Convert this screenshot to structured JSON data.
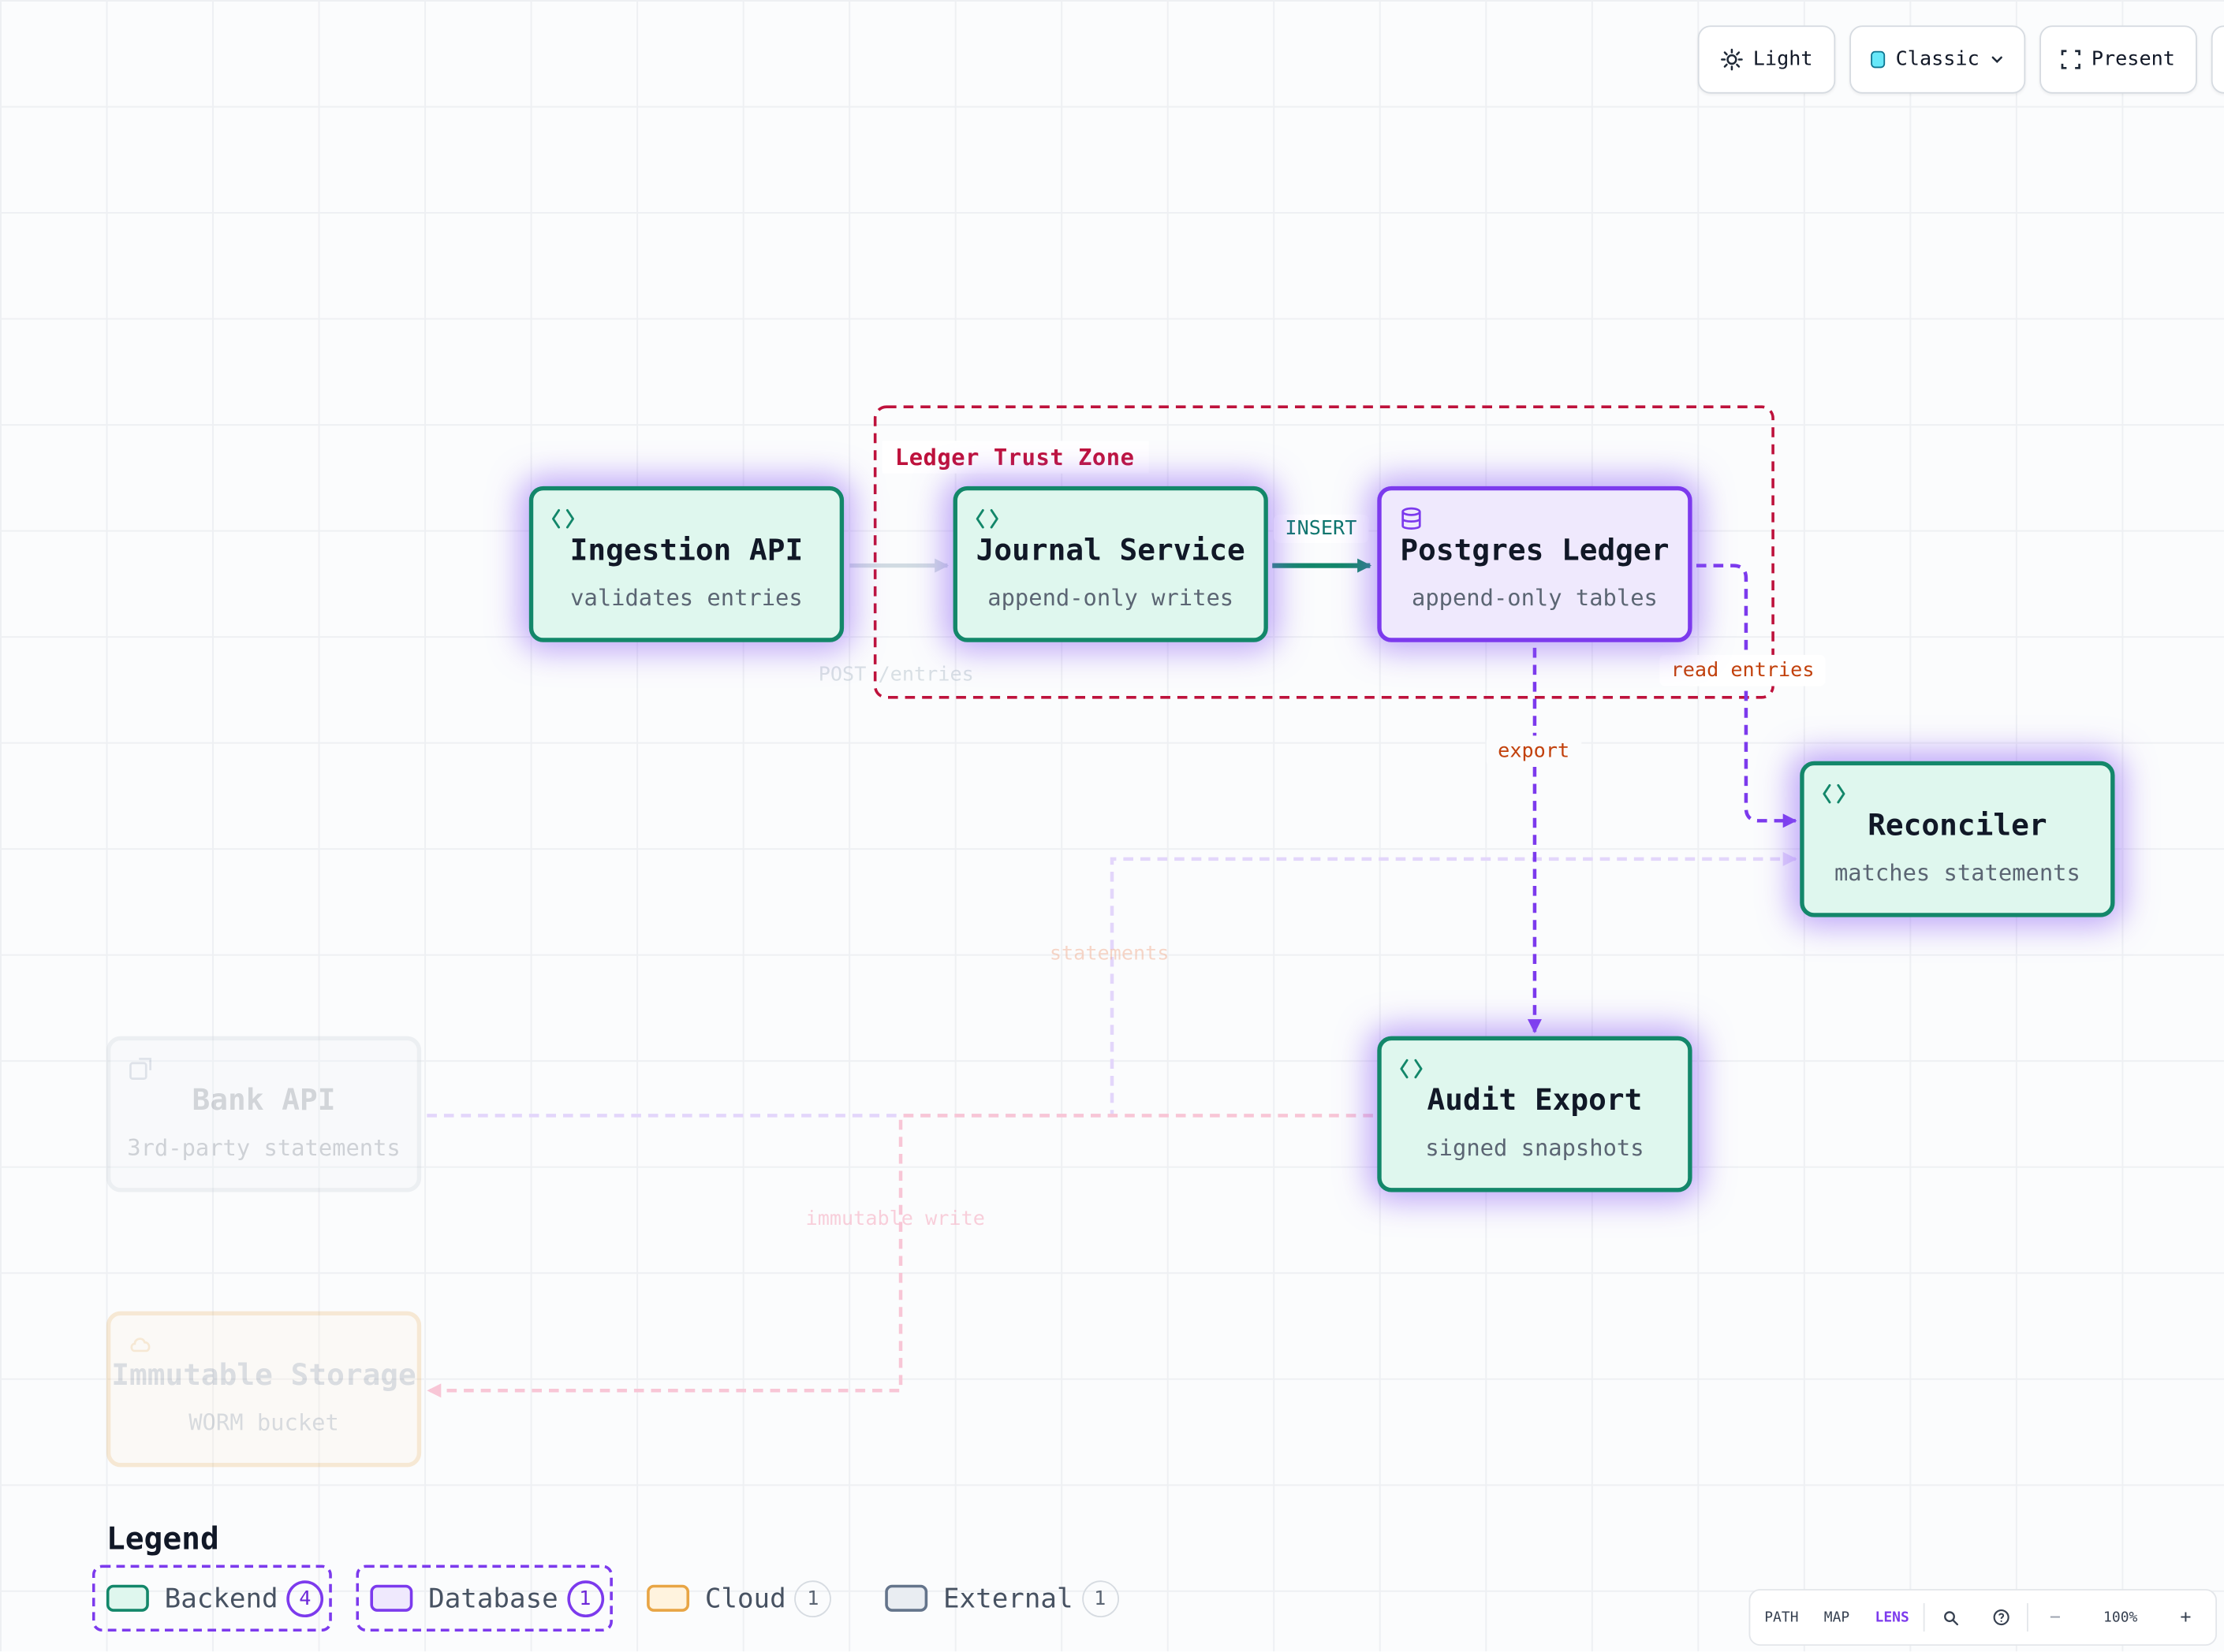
{
  "toolbar": {
    "theme_label": "Light",
    "style_label": "Classic",
    "present_label": "Present"
  },
  "zone": {
    "label": "Ledger Trust Zone",
    "color": "#be123c"
  },
  "nodes": {
    "ingestion": {
      "title": "Ingestion API",
      "subtitle": "validates entries",
      "kind": "backend",
      "icon": "code-brackets-icon"
    },
    "journal": {
      "title": "Journal Service",
      "subtitle": "append-only writes",
      "kind": "backend",
      "icon": "code-brackets-icon"
    },
    "postgres": {
      "title": "Postgres Ledger",
      "subtitle": "append-only tables",
      "kind": "database",
      "icon": "database-icon"
    },
    "reconciler": {
      "title": "Reconciler",
      "subtitle": "matches statements",
      "kind": "backend",
      "icon": "code-brackets-icon"
    },
    "audit": {
      "title": "Audit Export",
      "subtitle": "signed snapshots",
      "kind": "backend",
      "icon": "code-brackets-icon"
    },
    "bank": {
      "title": "Bank API",
      "subtitle": "3rd-party statements",
      "kind": "external",
      "icon": "external-link-icon"
    },
    "storage": {
      "title": "Immutable Storage",
      "subtitle": "WORM bucket",
      "kind": "cloud",
      "icon": "cloud-icon"
    }
  },
  "edges": {
    "post_entries": "POST /entries",
    "insert": "INSERT",
    "read_entries": "read entries",
    "export": "export",
    "statements": "statements",
    "immutable_write": "immutable write"
  },
  "legend": {
    "title": "Legend",
    "items": [
      {
        "label": "Backend",
        "count": "4",
        "color": "#13876a"
      },
      {
        "label": "Database",
        "count": "1",
        "color": "#7c3aed"
      },
      {
        "label": "Cloud",
        "count": "1",
        "color": "#e8a545"
      },
      {
        "label": "External",
        "count": "1",
        "color": "#c9d0d8"
      }
    ]
  },
  "bottombar": {
    "path_label": "PATH",
    "map_label": "MAP",
    "lens_label": "LENS",
    "zoom_out": "−",
    "zoom_level": "100%",
    "zoom_in": "+"
  },
  "colors": {
    "backend_border": "#13876a",
    "database_border": "#7c3aed",
    "accent": "#7c3aed",
    "edge_label_orange": "#c2410c"
  }
}
